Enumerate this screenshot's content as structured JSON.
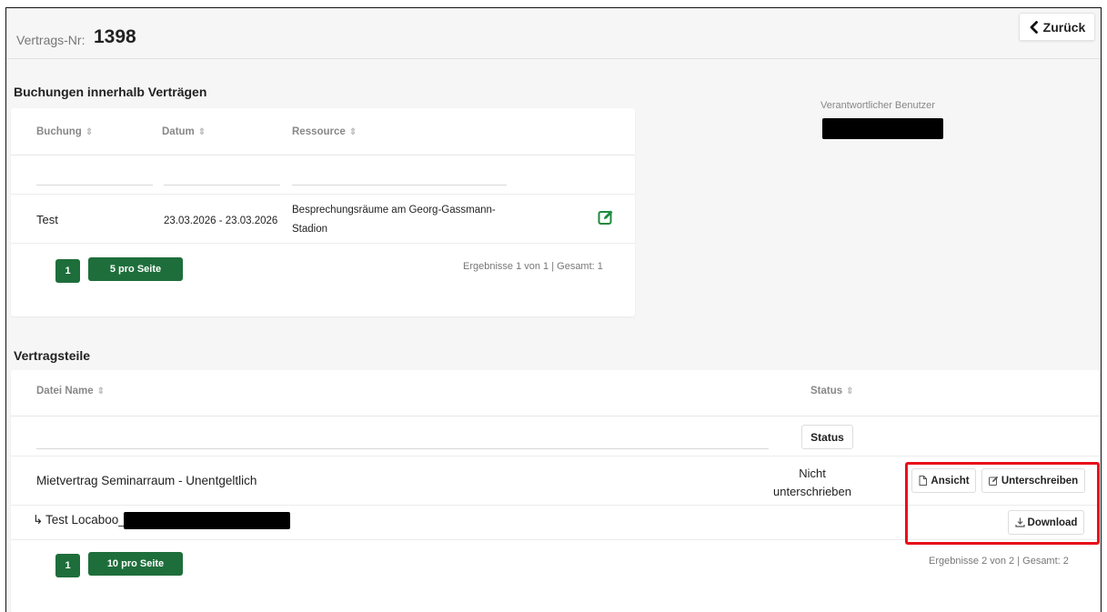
{
  "header": {
    "contract_label": "Vertrags-Nr:",
    "contract_number": "1398",
    "back_label": "Zurück"
  },
  "bookings": {
    "title": "Buchungen innerhalb Verträgen",
    "columns": [
      "Buchung",
      "Datum",
      "Ressource"
    ],
    "rows": [
      {
        "booking": "Test",
        "date": "23.03.2026 - 23.03.2026",
        "resource_line1": "Besprechungsräume am Georg-Gassmann-",
        "resource_line2": "Stadion"
      }
    ],
    "page": "1",
    "per_page": "5 pro Seite",
    "results": "Ergebnisse 1 von 1 | Gesamt: 1"
  },
  "responsible": {
    "label": "Verantwortlicher Benutzer"
  },
  "parts": {
    "title": "Vertragsteile",
    "columns": [
      "Datei Name",
      "Status"
    ],
    "status_filter_label": "Status",
    "rows": [
      {
        "name": "Mietvertrag Seminarraum - Unentgeltlich",
        "status_line1": "Nicht",
        "status_line2": "unterschrieben",
        "view_label": "Ansicht",
        "sign_label": "Unterschreiben"
      },
      {
        "name": "Test Locaboo_",
        "download_label": "Download"
      }
    ],
    "page": "1",
    "per_page": "10 pro Seite",
    "results": "Ergebnisse 2 von 2 | Gesamt: 2"
  },
  "colors": {
    "accent_green": "#1e6e3b",
    "highlight_red": "#e8101a"
  },
  "icons": [
    "chevron-left-icon",
    "sort-icon",
    "edit-icon",
    "file-icon",
    "pen-square-icon",
    "download-icon",
    "sub-item-arrow-icon"
  ]
}
